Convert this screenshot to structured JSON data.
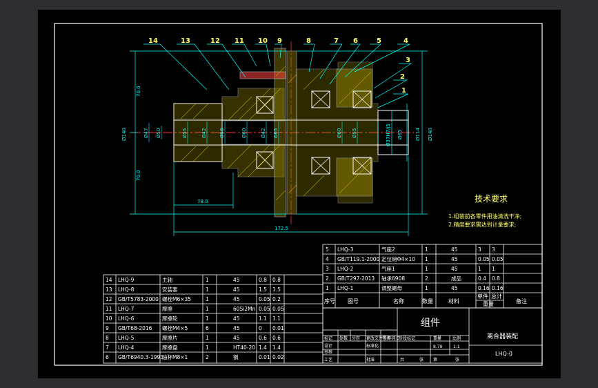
{
  "drawing": {
    "part_labels": [
      "14",
      "13",
      "12",
      "11",
      "10",
      "9",
      "8",
      "7",
      "6",
      "5",
      "4",
      "3",
      "2",
      "1"
    ],
    "dimensions": {
      "left_top_half": "70.0",
      "left_bottom_half": "70.0",
      "left_dia": "Ø140",
      "right_dia": "Ø140",
      "len_inner": "78.0",
      "len_total": "172.5",
      "right_dia_2": "Ø114",
      "right_dia_3": "Ø65",
      "fit": "Ø37H7/j5",
      "shaft_dias": [
        "Ø47",
        "Ø50",
        "Ø55",
        "Ø42",
        "Ø58",
        "Ø60",
        "Ø42",
        "Ø65",
        "Ø60",
        "Ø55"
      ]
    },
    "notes": {
      "title": "技术要求",
      "items": [
        "1.组装前各零件用油清洗干净;",
        "2.精度要求需达到计量要求;"
      ]
    }
  },
  "bom_right": {
    "rows": [
      [
        "5",
        "LHQ-3",
        "气座2",
        "1",
        "45",
        "3",
        "3"
      ],
      [
        "4",
        "GB/T119.1-2000",
        "定位销Φ4×10",
        "1",
        "45",
        "0.05",
        "0.05"
      ],
      [
        "3",
        "LHQ-2",
        "气座1",
        "1",
        "45",
        "1",
        "1"
      ],
      [
        "2",
        "GB/T297-2013",
        "轴承6908",
        "2",
        "成品",
        "0.4",
        "0.8"
      ],
      [
        "1",
        "LHQ-1",
        "调整螺母",
        "1",
        "45",
        "0.16",
        "0.16"
      ]
    ],
    "header": [
      "序号",
      "图号",
      "名称",
      "数量",
      "材料",
      "单件",
      "总计",
      "备注"
    ],
    "header_weight": "重量"
  },
  "bom_left": {
    "rows": [
      [
        "14",
        "LHQ-9",
        "主轴",
        "1",
        "45",
        "0.8",
        "0.8"
      ],
      [
        "13",
        "LHQ-8",
        "安装套",
        "1",
        "45",
        "1.5",
        "1.5"
      ],
      [
        "12",
        "GB/T5783-2000",
        "螺栓M6×35",
        "1",
        "45",
        "0.05",
        "0.2"
      ],
      [
        "11",
        "LHQ-7",
        "摩擦",
        "1",
        "60Si2Mn",
        "0.05",
        "0.05"
      ],
      [
        "10",
        "LHQ-6",
        "摩擦轮",
        "1",
        "45",
        "1.1",
        "1.1"
      ],
      [
        "9",
        "GB/T68-2016",
        "螺栓M4×5",
        "6",
        "45",
        "0",
        "0.01"
      ],
      [
        "8",
        "LHQ-5",
        "摩擦片",
        "1",
        "45",
        "0.6",
        "0.6"
      ],
      [
        "7",
        "LHQ-4",
        "摩擦盘",
        "1",
        "HT40-20",
        "1.4",
        "1.4"
      ],
      [
        "6",
        "GB/T6940.3-1993",
        "油杯M8×1",
        "2",
        "钢",
        "0.01",
        "0.02"
      ]
    ]
  },
  "title_block": {
    "name": "组件",
    "drawing_title": "离合器装配",
    "drawing_no": "LHQ-0",
    "cells": [
      "标记",
      "处数",
      "分区",
      "更改文件号",
      "签名",
      "年月日",
      "设计",
      "标准化",
      "阶段标记",
      "重量",
      "比例",
      "审核",
      "工艺",
      "批准",
      "共",
      "张",
      "第",
      "张"
    ],
    "weight": "8.79",
    "scale": "1:1"
  }
}
